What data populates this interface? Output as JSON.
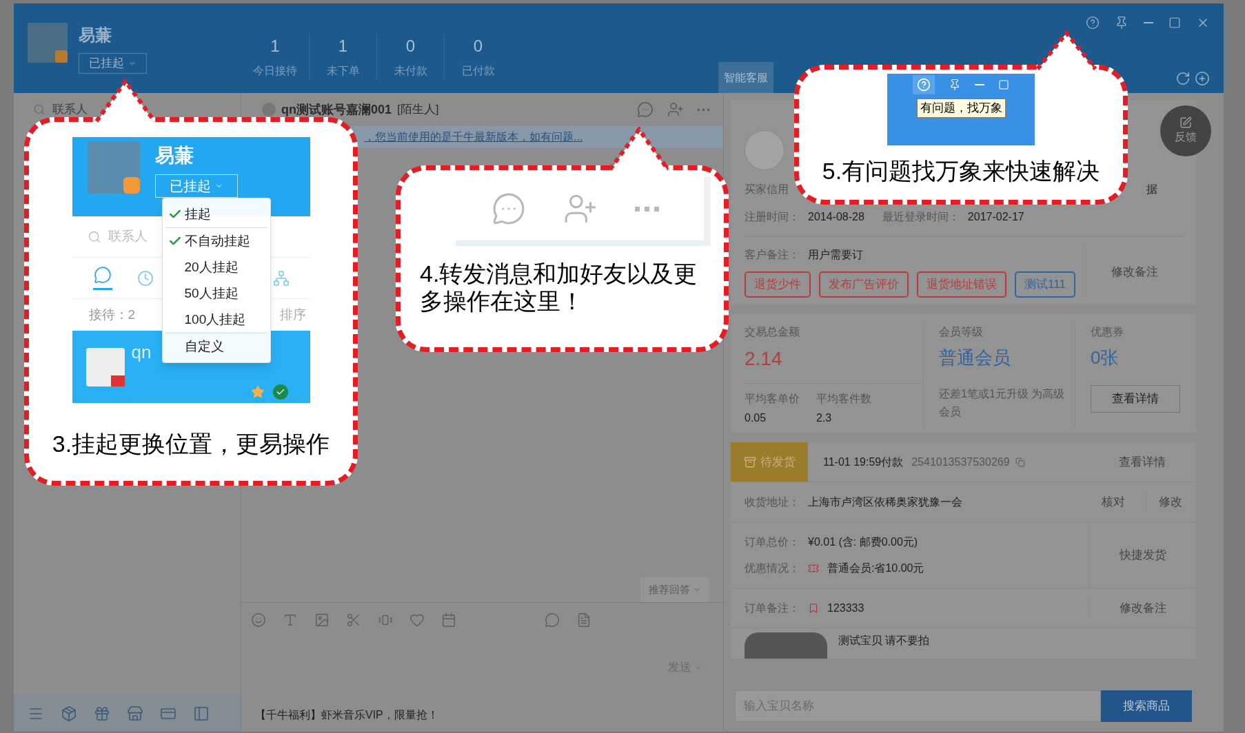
{
  "header": {
    "name": "易蒹",
    "status": "已挂起",
    "stats": [
      {
        "value": "1",
        "label": "今日接待"
      },
      {
        "value": "1",
        "label": "未下单"
      },
      {
        "value": "0",
        "label": "未付款"
      },
      {
        "value": "0",
        "label": "已付款"
      }
    ],
    "panel_tab": {
      "label": "智能客服",
      "selected": true
    }
  },
  "left": {
    "search_placeholder": "联系人"
  },
  "chat": {
    "contact": "qn测试账号嘉澜001",
    "contact_tag": "[陌生人]",
    "notice": "，您当前使用的是千牛最新版本，如有问题...",
    "recommend": "推荐回答",
    "send": "发送",
    "promo": "【千牛福利】虾米音乐VIP，限量抢！"
  },
  "buyer": {
    "credit_label": "买家信用",
    "credit_tail": "据",
    "reg_label": "注册时间：",
    "reg_date": "2014-08-28",
    "login_label": "最近登录时间：",
    "login_date": "2017-02-17",
    "note_label": "客户备注：",
    "note": "用户需要订",
    "edit_note": "修改备注",
    "tags": [
      {
        "text": "退货少件",
        "color": "#b83c3c"
      },
      {
        "text": "发布广告评价",
        "color": "#b83c3c"
      },
      {
        "text": "退货地址错误",
        "color": "#b83c3c"
      },
      {
        "text": "测试111",
        "color": "#2e64a0"
      }
    ]
  },
  "stats": {
    "total_label": "交易总金额",
    "total": "2.14",
    "level_label": "会员等级",
    "level": "普通会员",
    "coupon_label": "优惠券",
    "coupon": "0张",
    "avg_price_label": "平均客单价",
    "avg_price": "0.05",
    "avg_count_label": "平均客件数",
    "avg_count": "2.3",
    "upgrade": "还差1笔或1元升级 为高级会员",
    "details": "查看详情"
  },
  "order": {
    "status": "待发货",
    "paid": "11-01 19:59付款",
    "number": "2541013537530269",
    "details": "查看详情",
    "address_label": "收货地址：",
    "address": "上海市卢湾区依稀奥家犹豫一会",
    "verify": "核对",
    "edit": "修改",
    "total_label": "订单总价：",
    "total": "¥0.01 (含: 邮费0.00元)",
    "discount_label": "优惠情况：",
    "discount": "普通会员:省10.00元",
    "quick_ship": "快捷发货",
    "remark_label": "订单备注：",
    "remark": "123333",
    "edit_remark": "修改备注",
    "item": "测试宝贝 请不要拍"
  },
  "product_search": {
    "placeholder": "输入宝贝名称",
    "button": "搜索商品"
  },
  "feedback": "反馈",
  "callouts": [
    {
      "kind": "status-menu",
      "name": "易蒹",
      "status": "已挂起",
      "search_placeholder": "联系人",
      "reception": "接待：2",
      "sort": "排序",
      "contact": "qn",
      "menu": [
        {
          "label": "挂起",
          "checked": true
        },
        {
          "label": "不自动挂起",
          "checked": true
        },
        {
          "label": "20人挂起",
          "checked": false
        },
        {
          "label": "50人挂起",
          "checked": false
        },
        {
          "label": "100人挂起",
          "checked": false
        },
        {
          "label": "自定义",
          "checked": false
        }
      ],
      "caption": "3.挂起更换位置，更易操作"
    },
    {
      "kind": "chat-actions",
      "caption": "4.转发消息和加好友以及更多操作在这里！"
    },
    {
      "kind": "help-tooltip",
      "tooltip": "有问题，找万象",
      "caption": "5.有问题找万象来快速解决"
    }
  ]
}
